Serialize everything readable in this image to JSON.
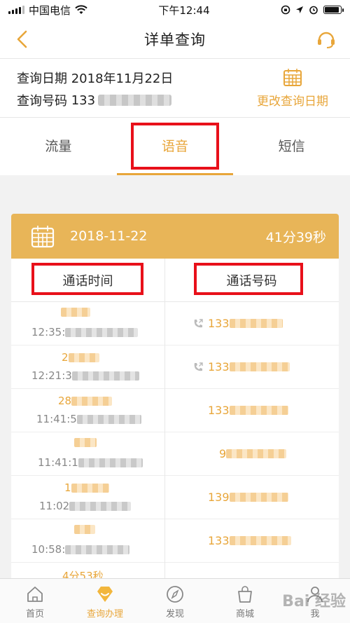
{
  "status_bar": {
    "carrier": "中国电信",
    "time": "下午12:44"
  },
  "nav": {
    "title": "详单查询"
  },
  "query": {
    "date_label": "查询日期",
    "date_value": "2018年11月22日",
    "number_label": "查询号码",
    "number_prefix": "133",
    "change_date_label": "更改查询日期"
  },
  "tabs": [
    {
      "label": "流量"
    },
    {
      "label": "语音"
    },
    {
      "label": "短信"
    }
  ],
  "card": {
    "date": "2018-11-22",
    "total_duration": "41分39秒"
  },
  "table": {
    "headers": [
      "通话时间",
      "通话号码"
    ],
    "rows": [
      {
        "duration": "",
        "time": "12:35:",
        "number": "133"
      },
      {
        "duration": "2",
        "time": "12:21:3",
        "number": "133"
      },
      {
        "duration": "28",
        "time": "11:41:5",
        "number": "133"
      },
      {
        "duration": "",
        "time": "11:41:1",
        "number": "9"
      },
      {
        "duration": "1",
        "time": "11:02",
        "number": "139"
      },
      {
        "duration": "",
        "time": "10:58:",
        "number": "133"
      },
      {
        "duration": "4分53秒",
        "time": "",
        "number": ""
      }
    ]
  },
  "tab_bar": [
    {
      "label": "首页"
    },
    {
      "label": "查询办理"
    },
    {
      "label": "发现"
    },
    {
      "label": "商城"
    },
    {
      "label": "我"
    }
  ],
  "watermark": "Bai 经验",
  "colors": {
    "accent": "#e8a63a",
    "card_header": "#e8b558",
    "highlight_box": "#e8101a"
  }
}
